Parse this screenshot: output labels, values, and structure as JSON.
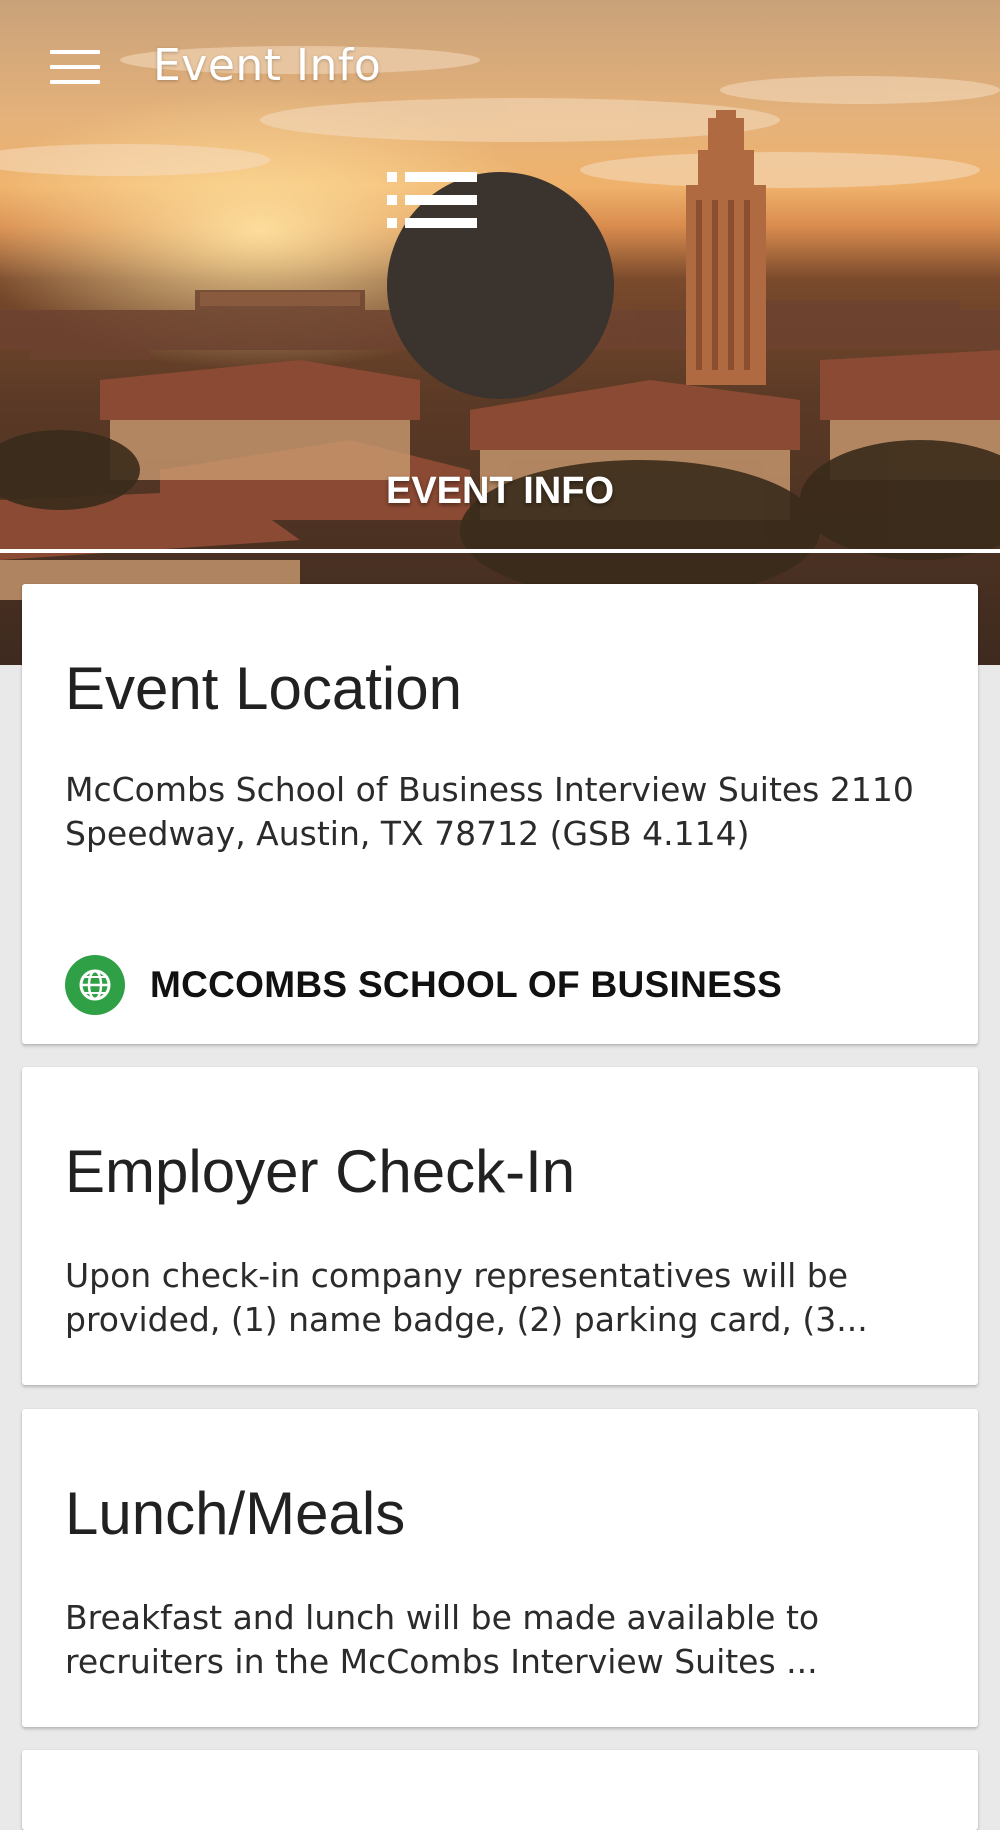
{
  "app": {
    "title": "Event Info"
  },
  "hero": {
    "label": "EVENT INFO",
    "icon": "list-icon",
    "circle_color": "#3b332d"
  },
  "cards": [
    {
      "title": "Event Location",
      "body": "McCombs School of Business Interview Suites 2110 Speedway, Austin, TX 78712 (GSB 4.114)",
      "link": {
        "icon": "globe-icon",
        "icon_color": "#2fa046",
        "label": "MCCOMBS SCHOOL OF BUSINESS"
      }
    },
    {
      "title": "Employer Check-In",
      "body": "Upon check-in company representatives will be provided, (1) name badge, (2) parking card, (3..."
    },
    {
      "title": "Lunch/Meals",
      "body": "Breakfast and lunch will be made available to recruiters in the McCombs Interview Suites ..."
    }
  ]
}
